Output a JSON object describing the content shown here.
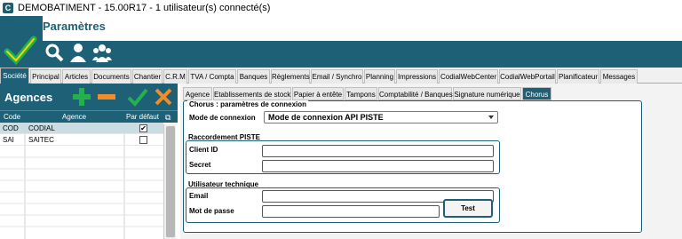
{
  "window": {
    "title": "DEMOBATIMENT - 15.00R17 - 1 utilisateur(s) connecté(s)"
  },
  "header": {
    "title": "Paramètres"
  },
  "icons": {
    "app": "app-logo-icon",
    "logo": "checkmark-logo-icon",
    "search": "search-icon",
    "user": "user-icon",
    "users": "users-group-icon"
  },
  "colors": {
    "brand": "#1e6176",
    "green": "#22b14c",
    "orange": "#f28c28",
    "white": "#ffffff"
  },
  "main_tabs": [
    {
      "label": "Société"
    },
    {
      "label": "Principal"
    },
    {
      "label": "Articles"
    },
    {
      "label": "Documents"
    },
    {
      "label": "Chantier"
    },
    {
      "label": "C.R.M"
    },
    {
      "label": "TVA / Compta"
    },
    {
      "label": "Banques"
    },
    {
      "label": "Règlements"
    },
    {
      "label": "Email / Synchro"
    },
    {
      "label": "Planning"
    },
    {
      "label": "Impressions"
    },
    {
      "label": "CodialWebCenter"
    },
    {
      "label": "CodialWebPortail"
    },
    {
      "label": "Planificateur"
    },
    {
      "label": "Messages"
    }
  ],
  "agences": {
    "title": "Agences",
    "columns": {
      "code": "Code",
      "agence": "Agence",
      "default": "Par défaut"
    },
    "rows": [
      {
        "code": "COD",
        "name": "CODIAL",
        "default": true
      },
      {
        "code": "SAI",
        "name": "SAITEC",
        "default": false
      }
    ]
  },
  "sub_tabs": [
    {
      "label": "Agence"
    },
    {
      "label": "Etablissements de stock"
    },
    {
      "label": "Papier à entête"
    },
    {
      "label": "Tampons"
    },
    {
      "label": "Comptabilité / Banques"
    },
    {
      "label": "Signature numérique"
    },
    {
      "label": "Chorus"
    }
  ],
  "chorus": {
    "legend": "Chorus : paramètres de connexion",
    "mode_label": "Mode de connexion",
    "mode_value": "Mode de connexion API PISTE",
    "raccordement_title": "Raccordement PISTE",
    "client_id_label": "Client ID",
    "client_id_value": "",
    "secret_label": "Secret",
    "secret_value": "",
    "user_title": "Utilisateur technique",
    "email_label": "Email",
    "email_value": "",
    "password_label": "Mot de passe",
    "password_value": "",
    "test_label": "Test"
  }
}
